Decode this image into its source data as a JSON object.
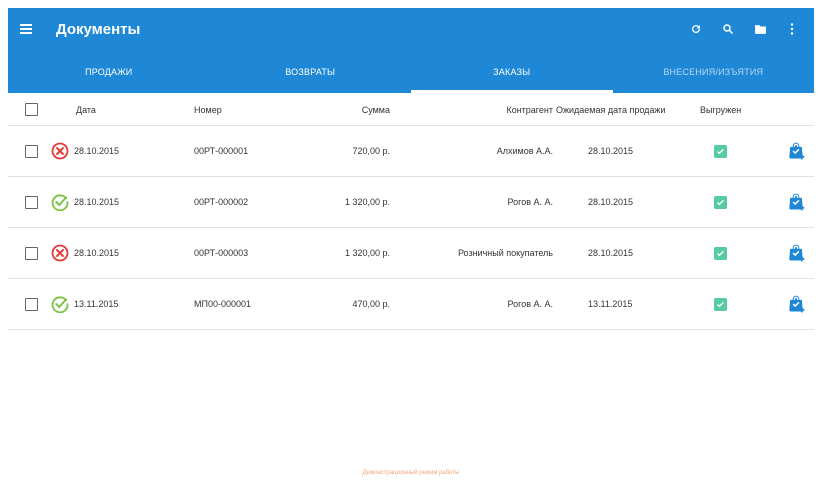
{
  "header": {
    "title": "Документы"
  },
  "toolbar_icons": [
    "refresh-icon",
    "search-icon",
    "folder-icon",
    "more-vert-icon"
  ],
  "tabs": [
    {
      "label": "ПРОДАЖИ",
      "active": false
    },
    {
      "label": "ВОЗВРАТЫ",
      "active": false
    },
    {
      "label": "ЗАКАЗЫ",
      "active": true
    },
    {
      "label": "ВНЕСЕНИЯ/ИЗЪЯТИЯ",
      "active": false
    }
  ],
  "columns": {
    "date": "Дата",
    "number": "Номер",
    "sum": "Сумма",
    "counterparty": "Контрагент",
    "expected_date": "Ожидаемая дата продажи",
    "uploaded": "Выгружен"
  },
  "rows": [
    {
      "status": "error",
      "date": "28.10.2015",
      "number": "00РТ-000001",
      "sum": "720,00 р.",
      "counterparty": "Алхимов А.А.",
      "expected_date": "28.10.2015",
      "uploaded": true
    },
    {
      "status": "ok",
      "date": "28.10.2015",
      "number": "00РТ-000002",
      "sum": "1 320,00 р.",
      "counterparty": "Рогов А. А.",
      "expected_date": "28.10.2015",
      "uploaded": true
    },
    {
      "status": "error",
      "date": "28.10.2015",
      "number": "00РТ-000003",
      "sum": "1 320,00 р.",
      "counterparty": "Розничный покупатель",
      "expected_date": "28.10.2015",
      "uploaded": true
    },
    {
      "status": "ok",
      "date": "13.11.2015",
      "number": "МП00-000001",
      "sum": "470,00 р.",
      "counterparty": "Рогов А. А.",
      "expected_date": "13.11.2015",
      "uploaded": true
    }
  ],
  "footer": {
    "note": "Демонстрационный режим работы"
  },
  "colors": {
    "primary": "#1e88d6",
    "error": "#e53935",
    "ok": "#7cc242",
    "synced": "#56c9a6",
    "action": "#1e88d6"
  }
}
